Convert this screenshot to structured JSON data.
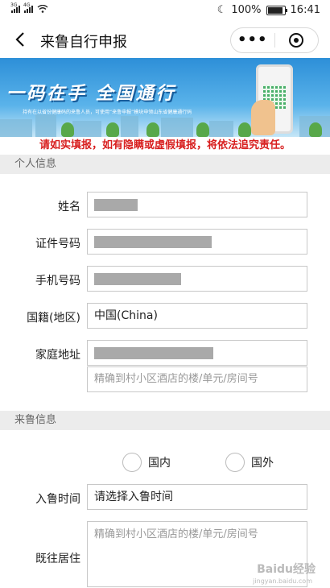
{
  "status": {
    "network_1": "3G",
    "network_2": "4G",
    "battery_percent": "100%",
    "battery_level": 1.0,
    "time": "16:41"
  },
  "header": {
    "title": "来鲁自行申报",
    "back_icon": "back-arrow-icon",
    "more_icon": "more-dots-icon",
    "close_icon": "target-icon"
  },
  "banner": {
    "headline": "一码在手  全国通行",
    "subtitle": "持有在以省份健康码的来鲁人员，可使用“来鲁申报”模块申领山东省健康通行码"
  },
  "warning": "请如实填报，如有隐瞒或虚假填报，将依法追究责任。",
  "personal": {
    "section_title": "个人信息",
    "name_label": "姓名",
    "id_label": "证件号码",
    "phone_label": "手机号码",
    "nationality_label": "国籍(地区)",
    "nationality_value": "中国(China)",
    "address_label": "家庭地址",
    "address_detail_placeholder": "精确到村小区酒店的楼/单元/房间号"
  },
  "arrival": {
    "section_title": "来鲁信息",
    "radio_domestic": "国内",
    "radio_abroad": "国外",
    "entry_time_label": "入鲁时间",
    "entry_time_placeholder": "请选择入鲁时间",
    "previous_residence_label": "既往居住",
    "previous_residence_placeholder": "精确到村小区酒店的楼/单元/房间号"
  },
  "watermark": {
    "logo": "Baidu经验",
    "url": "jingyan.baidu.com"
  }
}
